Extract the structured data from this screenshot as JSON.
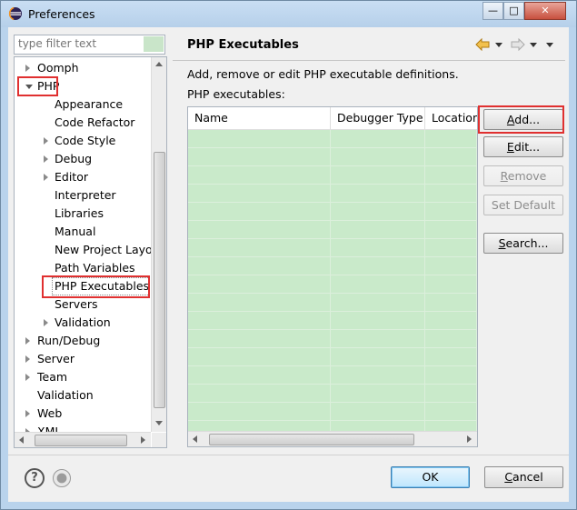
{
  "window": {
    "title": "Preferences",
    "controls": {
      "minimize": "—",
      "maximize": "□",
      "close": "✕"
    }
  },
  "filter": {
    "placeholder": "type filter text"
  },
  "tree": {
    "items": [
      {
        "label": "Oomph",
        "indent": 0,
        "twisty": "closed"
      },
      {
        "label": "PHP",
        "indent": 0,
        "twisty": "open"
      },
      {
        "label": "Appearance",
        "indent": 1,
        "twisty": "none"
      },
      {
        "label": "Code Refactor",
        "indent": 1,
        "twisty": "none"
      },
      {
        "label": "Code Style",
        "indent": 1,
        "twisty": "closed"
      },
      {
        "label": "Debug",
        "indent": 1,
        "twisty": "closed"
      },
      {
        "label": "Editor",
        "indent": 1,
        "twisty": "closed"
      },
      {
        "label": "Interpreter",
        "indent": 1,
        "twisty": "none"
      },
      {
        "label": "Libraries",
        "indent": 1,
        "twisty": "none"
      },
      {
        "label": "Manual",
        "indent": 1,
        "twisty": "none"
      },
      {
        "label": "New Project Layout",
        "indent": 1,
        "twisty": "none"
      },
      {
        "label": "Path Variables",
        "indent": 1,
        "twisty": "none"
      },
      {
        "label": "PHP Executables",
        "indent": 1,
        "twisty": "none",
        "selected": true
      },
      {
        "label": "Servers",
        "indent": 1,
        "twisty": "none"
      },
      {
        "label": "Validation",
        "indent": 1,
        "twisty": "closed"
      },
      {
        "label": "Run/Debug",
        "indent": 0,
        "twisty": "closed"
      },
      {
        "label": "Server",
        "indent": 0,
        "twisty": "closed"
      },
      {
        "label": "Team",
        "indent": 0,
        "twisty": "closed"
      },
      {
        "label": "Validation",
        "indent": 0,
        "twisty": "none"
      },
      {
        "label": "Web",
        "indent": 0,
        "twisty": "closed"
      },
      {
        "label": "XML",
        "indent": 0,
        "twisty": "closed"
      }
    ]
  },
  "page": {
    "title": "PHP Executables",
    "description": "Add, remove or edit PHP executable definitions.",
    "table_label": "PHP executables:",
    "columns": [
      "Name",
      "Debugger Type",
      "Location"
    ]
  },
  "buttons": {
    "add": {
      "pre": "",
      "u": "A",
      "post": "dd..."
    },
    "edit": {
      "pre": "",
      "u": "E",
      "post": "dit..."
    },
    "remove": {
      "pre": "",
      "u": "R",
      "post": "emove"
    },
    "set_default": "Set Default",
    "search": {
      "pre": "",
      "u": "S",
      "post": "earch..."
    },
    "ok": "OK",
    "cancel": {
      "pre": "",
      "u": "C",
      "post": "ancel"
    }
  },
  "icons": {
    "back": "back-arrow-icon",
    "forward": "forward-arrow-icon",
    "help": "?",
    "record": "record-icon"
  },
  "colors": {
    "highlight": "#e03030",
    "table_fill": "#c9eaca",
    "title_bg": "#b9d3ec",
    "back_arrow": "#e0a020"
  }
}
